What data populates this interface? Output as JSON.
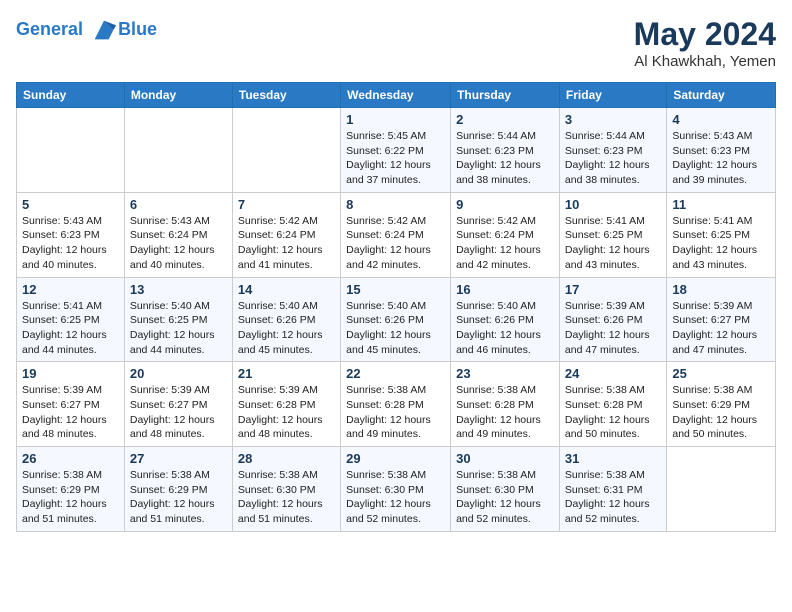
{
  "logo": {
    "line1": "General",
    "line2": "Blue"
  },
  "title": "May 2024",
  "location": "Al Khawkhah, Yemen",
  "weekdays": [
    "Sunday",
    "Monday",
    "Tuesday",
    "Wednesday",
    "Thursday",
    "Friday",
    "Saturday"
  ],
  "weeks": [
    [
      {
        "day": "",
        "info": ""
      },
      {
        "day": "",
        "info": ""
      },
      {
        "day": "",
        "info": ""
      },
      {
        "day": "1",
        "sunrise": "5:45 AM",
        "sunset": "6:22 PM",
        "daylight": "12 hours and 37 minutes."
      },
      {
        "day": "2",
        "sunrise": "5:44 AM",
        "sunset": "6:23 PM",
        "daylight": "12 hours and 38 minutes."
      },
      {
        "day": "3",
        "sunrise": "5:44 AM",
        "sunset": "6:23 PM",
        "daylight": "12 hours and 38 minutes."
      },
      {
        "day": "4",
        "sunrise": "5:43 AM",
        "sunset": "6:23 PM",
        "daylight": "12 hours and 39 minutes."
      }
    ],
    [
      {
        "day": "5",
        "sunrise": "5:43 AM",
        "sunset": "6:23 PM",
        "daylight": "12 hours and 40 minutes."
      },
      {
        "day": "6",
        "sunrise": "5:43 AM",
        "sunset": "6:24 PM",
        "daylight": "12 hours and 40 minutes."
      },
      {
        "day": "7",
        "sunrise": "5:42 AM",
        "sunset": "6:24 PM",
        "daylight": "12 hours and 41 minutes."
      },
      {
        "day": "8",
        "sunrise": "5:42 AM",
        "sunset": "6:24 PM",
        "daylight": "12 hours and 42 minutes."
      },
      {
        "day": "9",
        "sunrise": "5:42 AM",
        "sunset": "6:24 PM",
        "daylight": "12 hours and 42 minutes."
      },
      {
        "day": "10",
        "sunrise": "5:41 AM",
        "sunset": "6:25 PM",
        "daylight": "12 hours and 43 minutes."
      },
      {
        "day": "11",
        "sunrise": "5:41 AM",
        "sunset": "6:25 PM",
        "daylight": "12 hours and 43 minutes."
      }
    ],
    [
      {
        "day": "12",
        "sunrise": "5:41 AM",
        "sunset": "6:25 PM",
        "daylight": "12 hours and 44 minutes."
      },
      {
        "day": "13",
        "sunrise": "5:40 AM",
        "sunset": "6:25 PM",
        "daylight": "12 hours and 44 minutes."
      },
      {
        "day": "14",
        "sunrise": "5:40 AM",
        "sunset": "6:26 PM",
        "daylight": "12 hours and 45 minutes."
      },
      {
        "day": "15",
        "sunrise": "5:40 AM",
        "sunset": "6:26 PM",
        "daylight": "12 hours and 45 minutes."
      },
      {
        "day": "16",
        "sunrise": "5:40 AM",
        "sunset": "6:26 PM",
        "daylight": "12 hours and 46 minutes."
      },
      {
        "day": "17",
        "sunrise": "5:39 AM",
        "sunset": "6:26 PM",
        "daylight": "12 hours and 47 minutes."
      },
      {
        "day": "18",
        "sunrise": "5:39 AM",
        "sunset": "6:27 PM",
        "daylight": "12 hours and 47 minutes."
      }
    ],
    [
      {
        "day": "19",
        "sunrise": "5:39 AM",
        "sunset": "6:27 PM",
        "daylight": "12 hours and 48 minutes."
      },
      {
        "day": "20",
        "sunrise": "5:39 AM",
        "sunset": "6:27 PM",
        "daylight": "12 hours and 48 minutes."
      },
      {
        "day": "21",
        "sunrise": "5:39 AM",
        "sunset": "6:28 PM",
        "daylight": "12 hours and 48 minutes."
      },
      {
        "day": "22",
        "sunrise": "5:38 AM",
        "sunset": "6:28 PM",
        "daylight": "12 hours and 49 minutes."
      },
      {
        "day": "23",
        "sunrise": "5:38 AM",
        "sunset": "6:28 PM",
        "daylight": "12 hours and 49 minutes."
      },
      {
        "day": "24",
        "sunrise": "5:38 AM",
        "sunset": "6:28 PM",
        "daylight": "12 hours and 50 minutes."
      },
      {
        "day": "25",
        "sunrise": "5:38 AM",
        "sunset": "6:29 PM",
        "daylight": "12 hours and 50 minutes."
      }
    ],
    [
      {
        "day": "26",
        "sunrise": "5:38 AM",
        "sunset": "6:29 PM",
        "daylight": "12 hours and 51 minutes."
      },
      {
        "day": "27",
        "sunrise": "5:38 AM",
        "sunset": "6:29 PM",
        "daylight": "12 hours and 51 minutes."
      },
      {
        "day": "28",
        "sunrise": "5:38 AM",
        "sunset": "6:30 PM",
        "daylight": "12 hours and 51 minutes."
      },
      {
        "day": "29",
        "sunrise": "5:38 AM",
        "sunset": "6:30 PM",
        "daylight": "12 hours and 52 minutes."
      },
      {
        "day": "30",
        "sunrise": "5:38 AM",
        "sunset": "6:30 PM",
        "daylight": "12 hours and 52 minutes."
      },
      {
        "day": "31",
        "sunrise": "5:38 AM",
        "sunset": "6:31 PM",
        "daylight": "12 hours and 52 minutes."
      },
      {
        "day": "",
        "info": ""
      }
    ]
  ]
}
